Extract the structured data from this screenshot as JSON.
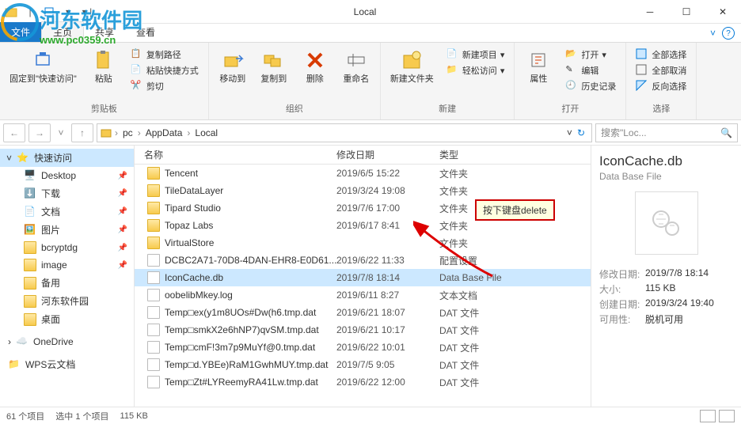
{
  "window": {
    "title": "Local"
  },
  "tabs": {
    "file": "文件",
    "home": "主页",
    "share": "共享",
    "view": "查看"
  },
  "ribbon": {
    "pin": "固定到\"快速访问\"",
    "paste": "粘贴",
    "copy_path": "复制路径",
    "paste_shortcut": "粘贴快捷方式",
    "cut": "剪切",
    "clipboard_group": "剪贴板",
    "move_to": "移动到",
    "copy_to": "复制到",
    "delete": "删除",
    "rename": "重命名",
    "organize_group": "组织",
    "new_folder": "新建文件夹",
    "new_item": "新建项目",
    "easy_access": "轻松访问",
    "new_group": "新建",
    "properties": "属性",
    "open_btn": "打开",
    "edit": "编辑",
    "history": "历史记录",
    "open_group": "打开",
    "select_all": "全部选择",
    "select_none": "全部取消",
    "invert_selection": "反向选择",
    "select_group": "选择"
  },
  "address": {
    "parts": [
      "pc",
      "AppData",
      "Local"
    ],
    "refresh": "↻",
    "search_placeholder": "搜索\"Loc..."
  },
  "sidebar": {
    "quick_access": "快速访问",
    "desktop": "Desktop",
    "downloads": "下载",
    "documents": "文档",
    "pictures": "图片",
    "bcryptdg": "bcryptdg",
    "image": "image",
    "backup": "备用",
    "hedong": "河东软件园",
    "desktop2": "桌面",
    "onedrive": "OneDrive",
    "wps": "WPS云文档"
  },
  "columns": {
    "name": "名称",
    "date": "修改日期",
    "type": "类型"
  },
  "files": [
    {
      "name": "Tencent",
      "date": "2019/6/5 15:22",
      "type": "文件夹",
      "kind": "folder"
    },
    {
      "name": "TileDataLayer",
      "date": "2019/3/24 19:08",
      "type": "文件夹",
      "kind": "folder"
    },
    {
      "name": "Tipard Studio",
      "date": "2019/7/6 17:00",
      "type": "文件夹",
      "kind": "folder"
    },
    {
      "name": "Topaz Labs",
      "date": "2019/6/17 8:41",
      "type": "文件夹",
      "kind": "folder"
    },
    {
      "name": "VirtualStore",
      "date": "",
      "type": "文件夹",
      "kind": "folder"
    },
    {
      "name": "DCBC2A71-70D8-4DAN-EHR8-E0D61...",
      "date": "2019/6/22 11:33",
      "type": "配置设置",
      "kind": "file"
    },
    {
      "name": "IconCache.db",
      "date": "2019/7/8 18:14",
      "type": "Data Base File",
      "kind": "file",
      "selected": true
    },
    {
      "name": "oobelibMkey.log",
      "date": "2019/6/11 8:27",
      "type": "文本文档",
      "kind": "file"
    },
    {
      "name": "Temp□ex(y1m8UOs#Dw(h6.tmp.dat",
      "date": "2019/6/21 18:07",
      "type": "DAT 文件",
      "kind": "file"
    },
    {
      "name": "Temp□smkX2e6hNP7)qvSM.tmp.dat",
      "date": "2019/6/21 10:17",
      "type": "DAT 文件",
      "kind": "file"
    },
    {
      "name": "Temp□cmF!3m7p9MuYf@0.tmp.dat",
      "date": "2019/6/22 10:01",
      "type": "DAT 文件",
      "kind": "file"
    },
    {
      "name": "Temp□d.YBEe)RaM1GwhMUY.tmp.dat",
      "date": "2019/7/5 9:05",
      "type": "DAT 文件",
      "kind": "file"
    },
    {
      "name": "Temp□Zt#LYReemyRA41Lw.tmp.dat",
      "date": "2019/6/22 12:00",
      "type": "DAT 文件",
      "kind": "file"
    }
  ],
  "tooltip": "按下键盘delete",
  "details": {
    "title": "IconCache.db",
    "subtitle": "Data Base File",
    "rows": [
      {
        "k": "修改日期:",
        "v": "2019/7/8 18:14"
      },
      {
        "k": "大小:",
        "v": "115 KB"
      },
      {
        "k": "创建日期:",
        "v": "2019/3/24 19:40"
      },
      {
        "k": "可用性:",
        "v": "脱机可用"
      }
    ]
  },
  "status": {
    "count": "61 个项目",
    "selected": "选中 1 个项目",
    "size": "115 KB"
  },
  "watermark": {
    "text": "河东软件园",
    "url": "www.pc0359.cn"
  }
}
